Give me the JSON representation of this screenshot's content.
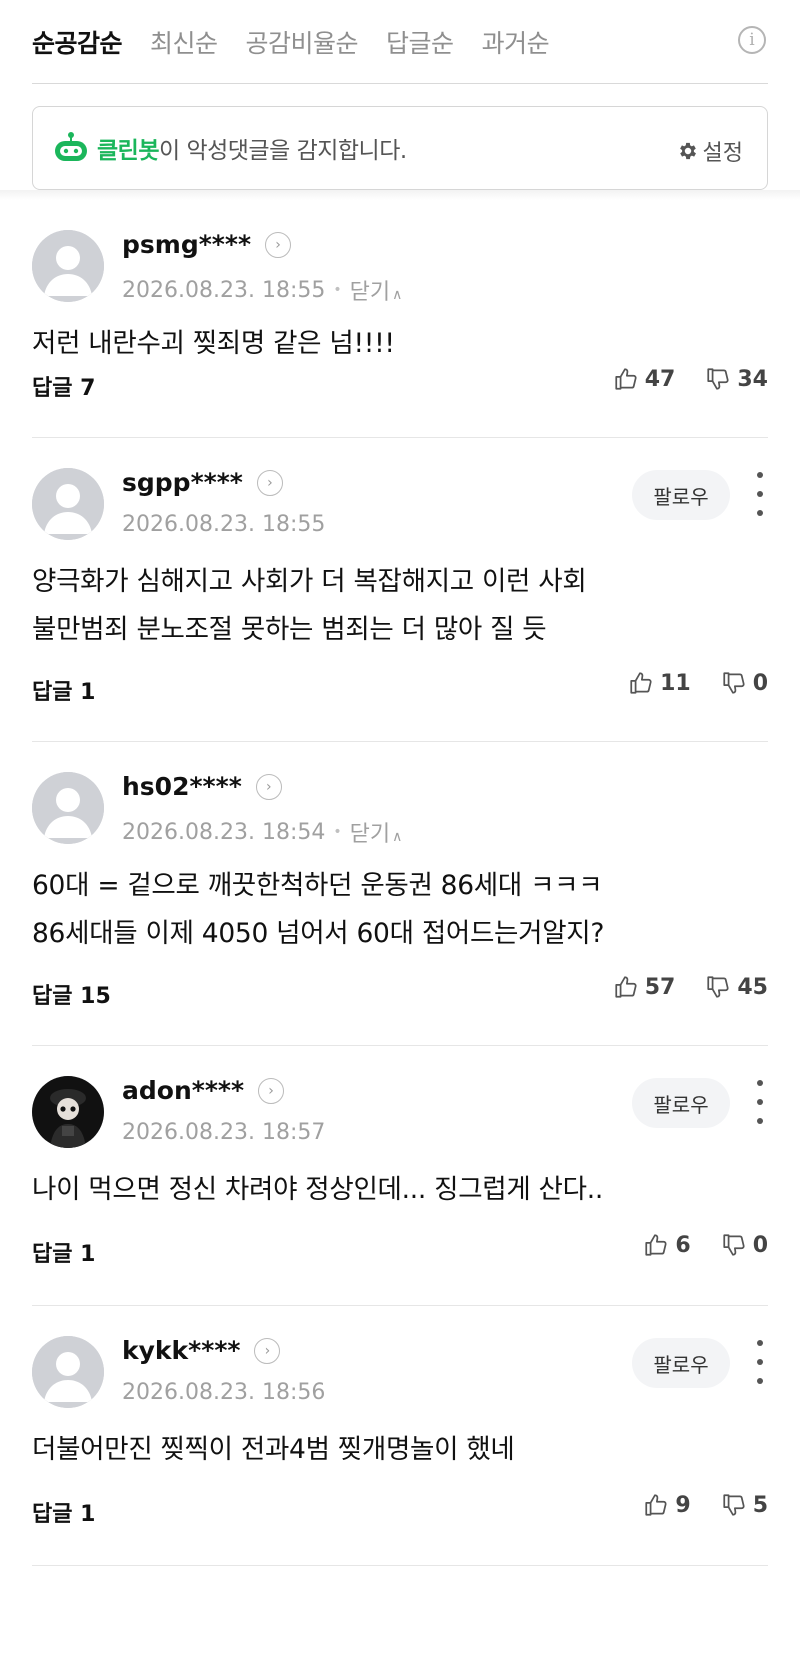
{
  "sort": {
    "tabs": [
      "순공감순",
      "최신순",
      "공감비율순",
      "답글순",
      "과거순"
    ],
    "active_index": 0
  },
  "cleanbot": {
    "brand": "클린봇",
    "message": "이 악성댓글을 감지합니다.",
    "settings_label": "설정",
    "brand_color": "#1bb65b"
  },
  "comments": [
    {
      "username": "psmg****",
      "timestamp": "2026.08.23. 18:55",
      "close_label": "닫기",
      "text": "저런 내란수괴 찢죄명 같은 넘!!!!",
      "reply_label": "답글 7",
      "likes": "47",
      "dislikes": "34",
      "follow_label": null,
      "avatar": "default"
    },
    {
      "username": "sgpp****",
      "timestamp": "2026.08.23. 18:55",
      "close_label": null,
      "text": "양극화가 심해지고 사회가 더 복잡해지고 이런 사회\n불만범죄 분노조절 못하는 범죄는 더 많아 질 듯",
      "reply_label": "답글 1",
      "likes": "11",
      "dislikes": "0",
      "follow_label": "팔로우",
      "avatar": "default"
    },
    {
      "username": "hs02****",
      "timestamp": "2026.08.23. 18:54",
      "close_label": "닫기",
      "text": "60대 = 겉으로 깨끗한척하던 운동권 86세대 ㅋㅋㅋ\n86세대들 이제 4050 넘어서 60대 접어드는거알지?",
      "reply_label": "답글 15",
      "likes": "57",
      "dislikes": "45",
      "follow_label": null,
      "avatar": "default"
    },
    {
      "username": "adon****",
      "timestamp": "2026.08.23. 18:57",
      "close_label": null,
      "text": "나이 먹으면 정신 차려야 정상인데... 징그럽게 산다..",
      "reply_label": "답글 1",
      "likes": "6",
      "dislikes": "0",
      "follow_label": "팔로우",
      "avatar": "photo"
    },
    {
      "username": "kykk****",
      "timestamp": "2026.08.23. 18:56",
      "close_label": null,
      "text": "더불어만진 찢찍이 전과4범 찢개명놀이 했네",
      "reply_label": "답글 1",
      "likes": "9",
      "dislikes": "5",
      "follow_label": "팔로우",
      "avatar": "default"
    }
  ]
}
